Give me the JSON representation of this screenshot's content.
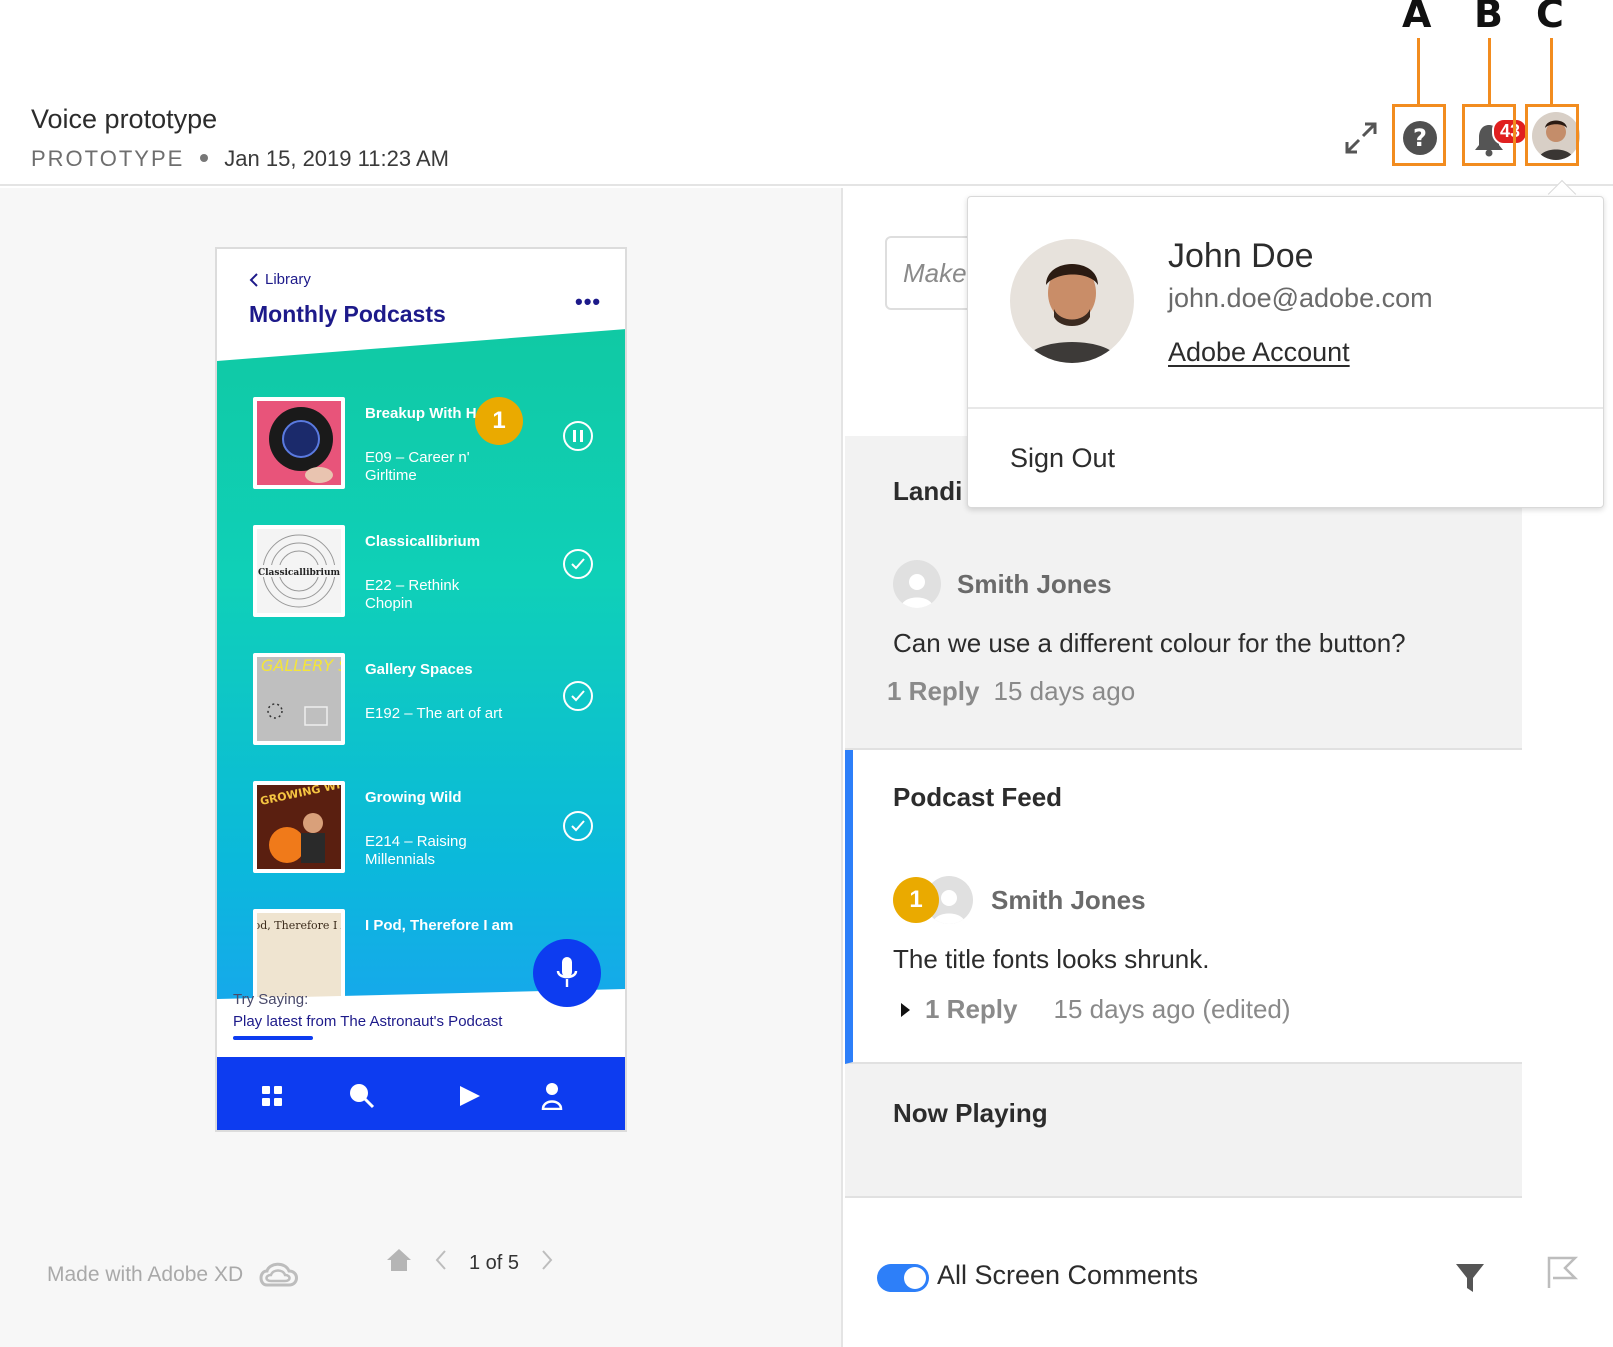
{
  "callouts": [
    "A",
    "B",
    "C"
  ],
  "header": {
    "title": "Voice prototype",
    "kind": "PROTOTYPE",
    "date": "Jan 15, 2019 11:23 AM",
    "notification_count": "43"
  },
  "phone": {
    "back_label": "Library",
    "title": "Monthly Podcasts",
    "more": "•••",
    "hotspot": "1",
    "tracks": [
      {
        "name": "Breakup With H",
        "episode": "E09 – Career n' Girltime",
        "status": "pause"
      },
      {
        "name": "Classicallibrium",
        "episode": "E22 – Rethink Chopin",
        "status": "check",
        "art_text": "Classicallibrium"
      },
      {
        "name": "Gallery Spaces",
        "episode": "E192 – The art of art",
        "status": "check",
        "art_text": "GALLERY SPACES"
      },
      {
        "name": "Growing Wild",
        "episode": "E214 – Raising Millennials",
        "status": "check",
        "art_text": "GROWING WILD"
      },
      {
        "name": "I Pod, Therefore I am",
        "episode": "",
        "status": "",
        "art_text": "I Pod, Therefore I Am"
      }
    ],
    "try_label": "Try Saying:",
    "try_text": "Play latest from The Astronaut's Podcast",
    "tabs": [
      "grid-icon",
      "search-icon",
      "play-icon",
      "profile-icon"
    ]
  },
  "footer": {
    "made_with": "Made with Adobe XD",
    "page_indicator": "1 of 5"
  },
  "comments": {
    "input_placeholder": "Make",
    "threads": [
      {
        "title": "Landi",
        "author": "Smith Jones",
        "text": "Can we use a different colour for the button?",
        "replies": "1 Reply",
        "time": "15 days ago"
      },
      {
        "title": "Podcast Feed",
        "pin": "1",
        "author": "Smith Jones",
        "text": "The title fonts looks shrunk.",
        "replies": "1 Reply",
        "time": "15 days ago (edited)"
      },
      {
        "title": "Now Playing"
      }
    ],
    "toggle_label": "All Screen Comments"
  },
  "account": {
    "name": "John Doe",
    "email": "john.doe@adobe.com",
    "account_link": "Adobe Account",
    "sign_out": "Sign Out"
  },
  "colors": {
    "accent": "#2d7ff9",
    "callout": "#f28c1f",
    "hotspot": "#eaaa00",
    "phone_blue": "#0d3cf0",
    "badge": "#e02020"
  }
}
